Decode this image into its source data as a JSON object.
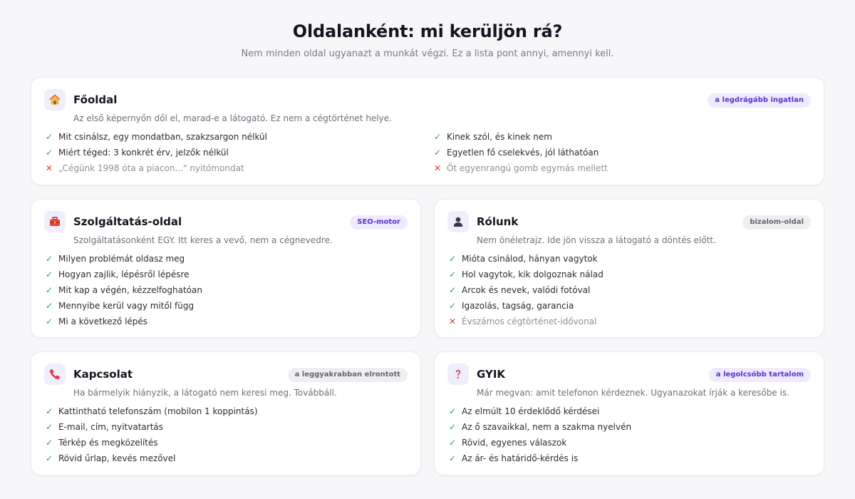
{
  "header": {
    "title": "Oldalanként: mi kerüljön rá?",
    "subtitle": "Nem minden oldal ugyanazt a munkát végzi. Ez a lista pont annyi, amennyi kell."
  },
  "colors": {
    "check": "#2f9b5e",
    "cross": "#d9403a",
    "accent": "#5b34c9"
  },
  "cards": {
    "home": {
      "icon": "house-icon",
      "title": "Főoldal",
      "badge": "a legdrágább ingatlan",
      "desc": "Az első képernyőn dől el, marad-e a látogató. Ez nem a cégtörténet helye.",
      "col1": [
        {
          "mark": "✓",
          "text": "Mit csinálsz, egy mondatban, szakzsargon nélkül"
        },
        {
          "mark": "✓",
          "text": "Miért téged: 3 konkrét érv, jelzők nélkül"
        },
        {
          "mark": "✕",
          "text": "„Cégünk 1998 óta a piacon...\" nyitómondat"
        }
      ],
      "col2": [
        {
          "mark": "✓",
          "text": "Kinek szól, és kinek nem"
        },
        {
          "mark": "✓",
          "text": "Egyetlen fő cselekvés, jól láthatóan"
        },
        {
          "mark": "✕",
          "text": "Öt egyenrangú gomb egymás mellett"
        }
      ]
    },
    "service": {
      "icon": "toolbox-icon",
      "title": "Szolgáltatás-oldal",
      "badge": "SEO-motor",
      "desc": "Szolgáltatásonként EGY. Itt keres a vevő, nem a cégnevedre.",
      "items": [
        {
          "mark": "✓",
          "text": "Milyen problémát oldasz meg"
        },
        {
          "mark": "✓",
          "text": "Hogyan zajlik, lépésről lépésre"
        },
        {
          "mark": "✓",
          "text": "Mit kap a végén, kézzelfoghatóan"
        },
        {
          "mark": "✓",
          "text": "Mennyibe kerül vagy mitől függ"
        },
        {
          "mark": "✓",
          "text": "Mi a következő lépés"
        }
      ]
    },
    "about": {
      "icon": "person-icon",
      "title": "Rólunk",
      "badge": "bizalom-oldal",
      "desc": "Nem önéletrajz. Ide jön vissza a látogató a döntés előtt.",
      "items": [
        {
          "mark": "✓",
          "text": "Mióta csinálod, hányan vagytok"
        },
        {
          "mark": "✓",
          "text": "Hol vagytok, kik dolgoznak nálad"
        },
        {
          "mark": "✓",
          "text": "Arcok és nevek, valódi fotóval"
        },
        {
          "mark": "✓",
          "text": "Igazolás, tagság, garancia"
        },
        {
          "mark": "✕",
          "text": "Évszámos cégtörténet-idővonal"
        }
      ]
    },
    "contact": {
      "icon": "phone-icon",
      "title": "Kapcsolat",
      "badge": "a leggyakrabban elrontott",
      "desc": "Ha bármelyik hiányzik, a látogató nem keresi meg. Továbbáll.",
      "items": [
        {
          "mark": "✓",
          "text": "Kattintható telefonszám (mobilon 1 koppintás)"
        },
        {
          "mark": "✓",
          "text": "E-mail, cím, nyitvatartás"
        },
        {
          "mark": "✓",
          "text": "Térkép és megközelítés"
        },
        {
          "mark": "✓",
          "text": "Rövid űrlap, kevés mezővel"
        }
      ]
    },
    "faq": {
      "icon": "question-mark-icon",
      "title": "GYIK",
      "badge": "a legolcsóbb tartalom",
      "desc": "Már megvan: amit telefonon kérdeznek. Ugyanazokat írják a keresőbe is.",
      "items": [
        {
          "mark": "✓",
          "text": "Az elmúlt 10 érdeklődő kérdései"
        },
        {
          "mark": "✓",
          "text": "Az ő szavaikkal, nem a szakma nyelvén"
        },
        {
          "mark": "✓",
          "text": "Rövid, egyenes válaszok"
        },
        {
          "mark": "✓",
          "text": "Az ár- és határidő-kérdés is"
        }
      ]
    }
  }
}
